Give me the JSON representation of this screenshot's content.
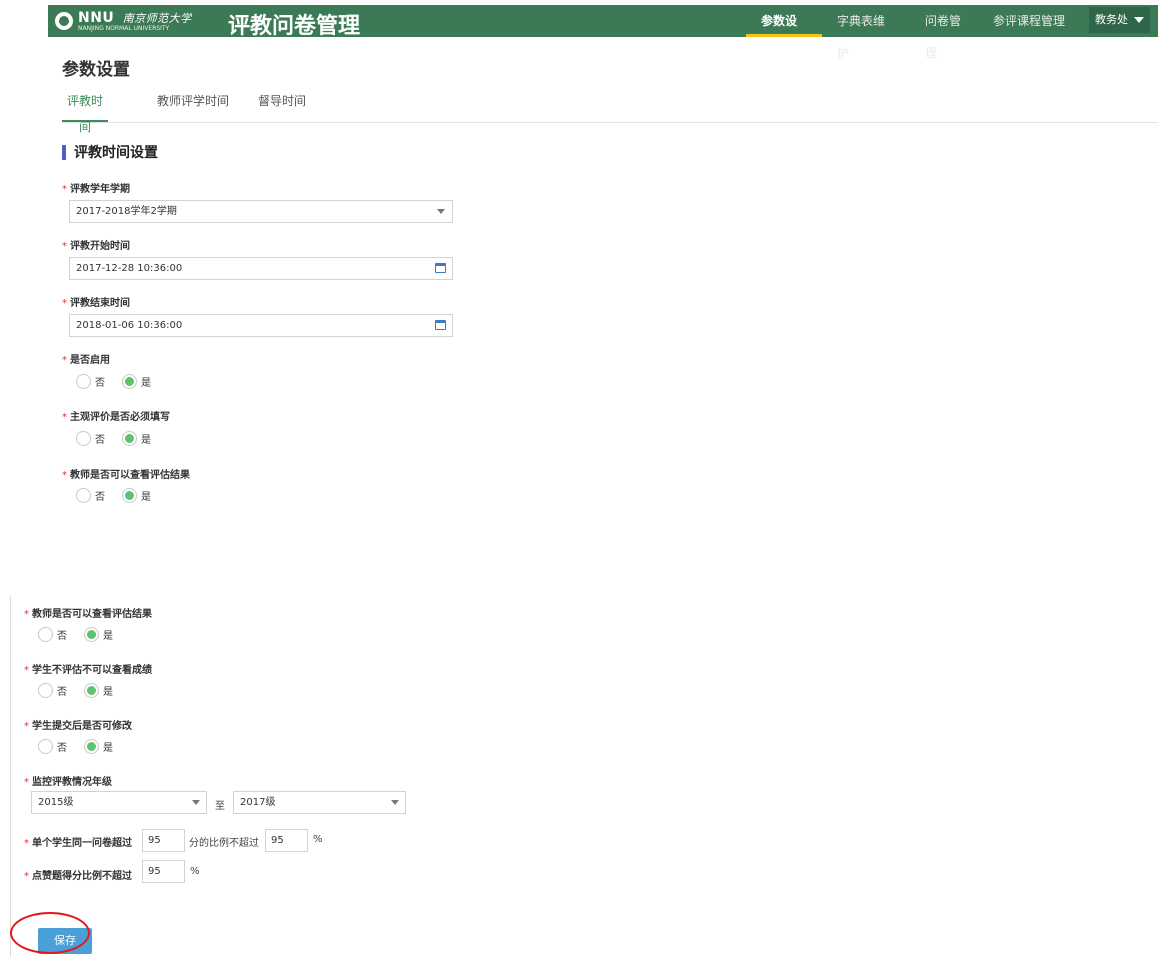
{
  "header": {
    "logo_text": "NNU",
    "logo_university_cn": "南京师范大学",
    "logo_university_en": "NANJING NORMAL UNIVERSITY",
    "app_title": "评教问卷管理",
    "nav": [
      "参数设置",
      "字典表维护",
      "问卷管理",
      "参评课程管理"
    ],
    "active_nav": "参数设置",
    "user_menu": "教务处"
  },
  "page_title": "参数设置",
  "tabs": [
    "评教时间",
    "教师评学时间",
    "督导时间"
  ],
  "active_tab": "评教时间",
  "section_title": "评教时间设置",
  "form": {
    "required_mark": "*",
    "term_label": "评教学年学期",
    "term_value": "2017-2018学年2学期",
    "start_label": "评教开始时间",
    "start_value": "2017-12-28 10:36:00",
    "end_label": "评教结束时间",
    "end_value": "2018-01-06 10:36:00",
    "enable_label": "是否启用",
    "subjective_label": "主观评价是否必须填写",
    "teacher_view_label": "教师是否可以查看评估结果",
    "option_no": "否",
    "option_yes": "是"
  },
  "lower_form": {
    "teacher_view_label": "教师是否可以查看评估结果",
    "student_no_eval_label": "学生不评估不可以查看成绩",
    "student_modify_label": "学生提交后是否可修改",
    "grade_label": "监控评教情况年级",
    "grade_from": "2015级",
    "grade_to_text": "至",
    "grade_to": "2017级",
    "same_q_label": "单个学生同一问卷超过",
    "same_q_value1": "95",
    "same_q_middle": "分的比例不超过",
    "same_q_value2": "95",
    "percent": "%",
    "like_label": "点赞题得分比例不超过",
    "like_value": "95",
    "save_button": "保存"
  },
  "colors": {
    "header_bg": "#3c7a56",
    "accent_tab": "#3c8b5a",
    "radio_checked": "#5cc46e",
    "save_button": "#4a9fd8",
    "annotation": "#e01a1a"
  }
}
